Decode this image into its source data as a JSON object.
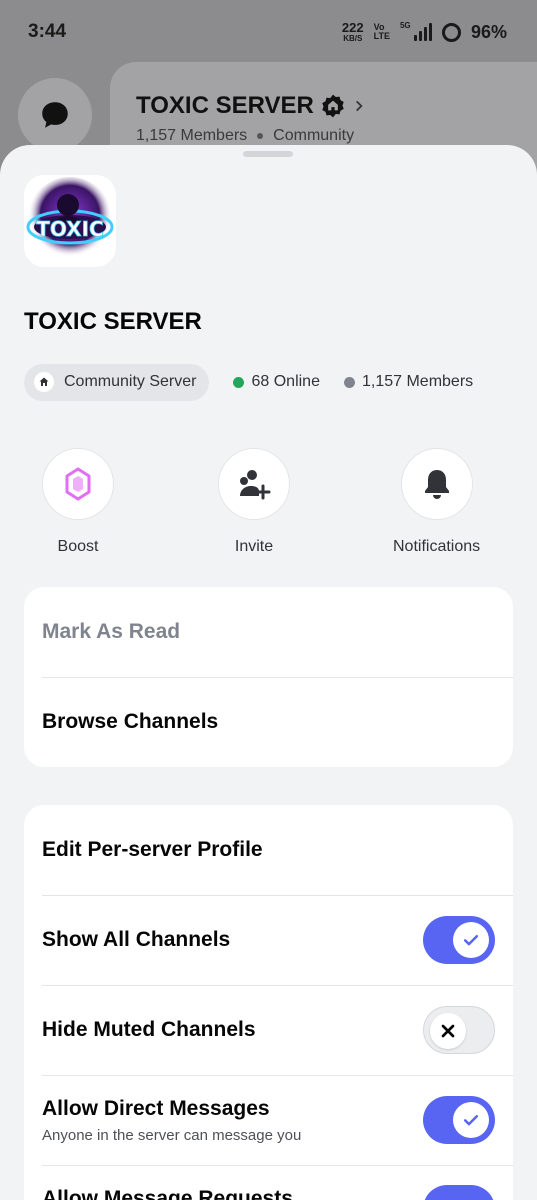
{
  "statusbar": {
    "time": "3:44",
    "net_speed": "222",
    "net_unit": "KB/S",
    "volte_top": "Vo",
    "volte_bottom": "LTE",
    "network": "5G",
    "battery": "96%"
  },
  "background": {
    "server_title": "TOXIC SERVER",
    "members": "1,157 Members",
    "type": "Community"
  },
  "sheet": {
    "server_name": "TOXIC SERVER",
    "icon_text": "TOXIC",
    "community_chip": "Community Server",
    "online": "68 Online",
    "members": "1,157 Members",
    "colors": {
      "online": "#23a55a",
      "members": "#80848e",
      "accent": "#5865f2",
      "boost": "#e26ef6"
    }
  },
  "actions": [
    {
      "label": "Boost",
      "icon": "boost-gem-icon"
    },
    {
      "label": "Invite",
      "icon": "add-user-icon"
    },
    {
      "label": "Notifications",
      "icon": "bell-icon"
    }
  ],
  "menu_primary": {
    "mark_as_read": "Mark As Read",
    "browse_channels": "Browse Channels"
  },
  "menu_settings": {
    "edit_profile": "Edit Per-server Profile",
    "show_all_channels": {
      "label": "Show All Channels",
      "enabled": true
    },
    "hide_muted_channels": {
      "label": "Hide Muted Channels",
      "enabled": false
    },
    "allow_direct_messages": {
      "label": "Allow Direct Messages",
      "sub": "Anyone in the server can message you",
      "enabled": true
    },
    "allow_message_requests": {
      "label": "Allow Message Requests"
    }
  }
}
